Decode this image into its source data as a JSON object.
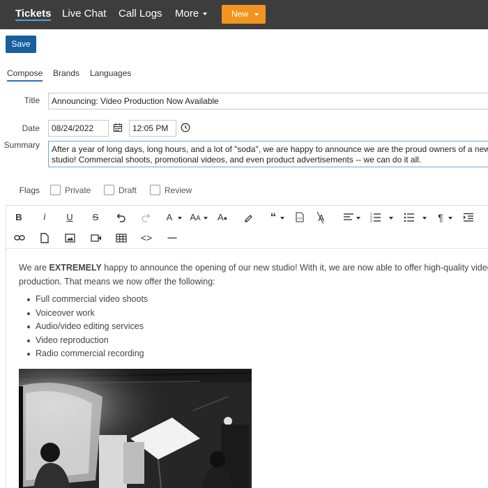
{
  "nav": {
    "items": [
      {
        "label": "Tickets",
        "active": true
      },
      {
        "label": "Live Chat"
      },
      {
        "label": "Call Logs"
      },
      {
        "label": "More"
      }
    ],
    "new_label": "New"
  },
  "save_label": "Save",
  "tabs": [
    "Compose",
    "Brands",
    "Languages"
  ],
  "form": {
    "title_label": "Title",
    "title_value": "Announcing: Video Production Now Available",
    "date_label": "Date",
    "date_value": "08/24/2022",
    "time_value": "12:05 PM",
    "summary_label": "Summary",
    "summary_line1": "After a year of long days, long hours, and a lot of \"soda\", we are happy to announce we are the proud owners of a new",
    "summary_line2": "studio! Commercial shoots, promotional videos, and even product advertisements -- we can do it all.",
    "flags_label": "Flags",
    "flags": [
      "Private",
      "Draft",
      "Review"
    ]
  },
  "editor": {
    "para_before": "We are ",
    "para_bold": "EXTREMELY",
    "para_after": " happy to announce the opening of our new studio! With it, we are now able to offer high-quality video a",
    "para_line2": "production. That means we now offer the following:",
    "list": [
      "Full commercial video shoots",
      "Voiceover work",
      "Audio/video editing services",
      "Video reproduction",
      "Radio commercial recording"
    ]
  },
  "colors": {
    "nav_bg": "#3d3d3d",
    "new_button": "#f29420",
    "save_button": "#17609e",
    "active_underline": "#4ba3e6"
  }
}
